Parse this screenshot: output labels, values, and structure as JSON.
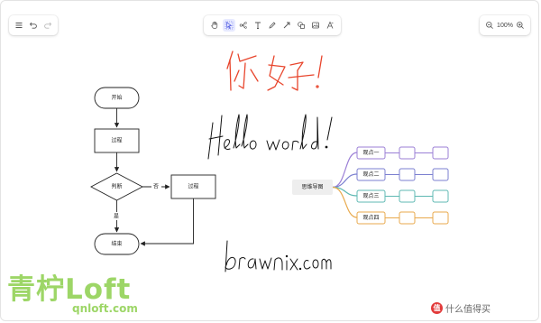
{
  "toolbar_left": {
    "icons": [
      "menu-icon",
      "undo-icon",
      "redo-icon"
    ]
  },
  "toolbar_center": {
    "tools": [
      "hand-icon",
      "select-icon",
      "mindmap-icon",
      "text-icon",
      "pen-icon",
      "arrow-icon",
      "shape-icon",
      "image-icon",
      "more-icon"
    ],
    "active": "select-icon"
  },
  "toolbar_right": {
    "zoom": "100%",
    "icons": [
      "zoom-out-icon",
      "zoom-in-icon"
    ]
  },
  "flowchart": {
    "start": "开始",
    "process1": "过程",
    "decision": "判断",
    "process2": "过程",
    "end": "结束",
    "no_label": "否",
    "yes_label": "是"
  },
  "mindmap": {
    "root": "思维导图",
    "branches": [
      {
        "label": "观点一",
        "color": "#9b7fd6"
      },
      {
        "label": "观点二",
        "color": "#7b7fd0"
      },
      {
        "label": "观点三",
        "color": "#5fb9b3"
      },
      {
        "label": "观点四",
        "color": "#e8a94c"
      }
    ]
  },
  "handwriting": {
    "chinese": "你好!",
    "english": "Hello world!",
    "url": "drawnix.com",
    "chinese_color": "#e8452c",
    "ink_color": "#111111"
  },
  "watermarks": {
    "left_main": "青柠Loft",
    "left_sub": "qnloft.com",
    "right_badge": "值",
    "right_text": "什么值得买"
  }
}
